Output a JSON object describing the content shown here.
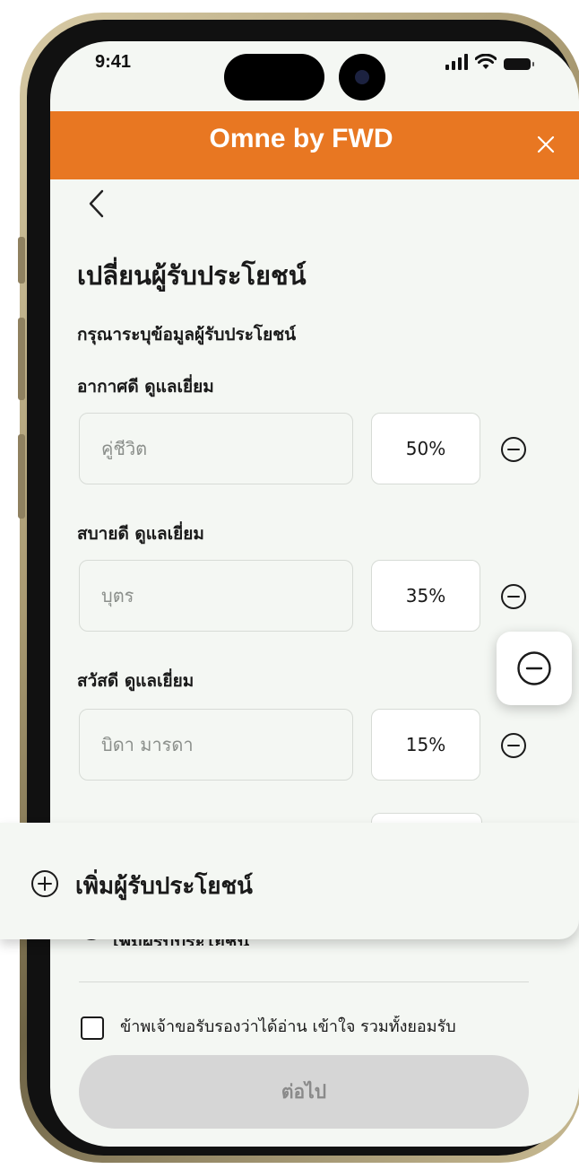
{
  "status_bar": {
    "time": "9:41"
  },
  "header": {
    "title": "Omne by FWD"
  },
  "page": {
    "title": "เปลี่ยนผู้รับประโยชน์",
    "subtitle": "กรุณาระบุข้อมูลผู้รับประโยชน์"
  },
  "beneficiaries": [
    {
      "name": "อากาศดี ดูแลเยี่ยม",
      "relation_placeholder": "คู่ชีวิต",
      "percent": "50%"
    },
    {
      "name": "สบายดี ดูแลเยี่ยม",
      "relation_placeholder": "บุตร",
      "percent": "35%"
    },
    {
      "name": "สวัสดี ดูแลเยี่ยม",
      "relation_placeholder": "บิดา มารดา",
      "percent": "15%"
    }
  ],
  "add_beneficiary": {
    "label": "เพิ่มผู้รับประโยชน์"
  },
  "consent": {
    "text": "ข้าพเจ้าขอรับรองว่าได้อ่าน เข้าใจ รวมทั้งยอมรับ"
  },
  "next_button": {
    "label": "ต่อไป"
  },
  "colors": {
    "brand_orange": "#e87722",
    "screen_bg": "#f4f7f3",
    "disabled_button": "#d6d6d6"
  },
  "icons": [
    "close-icon",
    "back-icon",
    "minus-circle-icon",
    "plus-circle-icon",
    "checkbox-icon"
  ]
}
